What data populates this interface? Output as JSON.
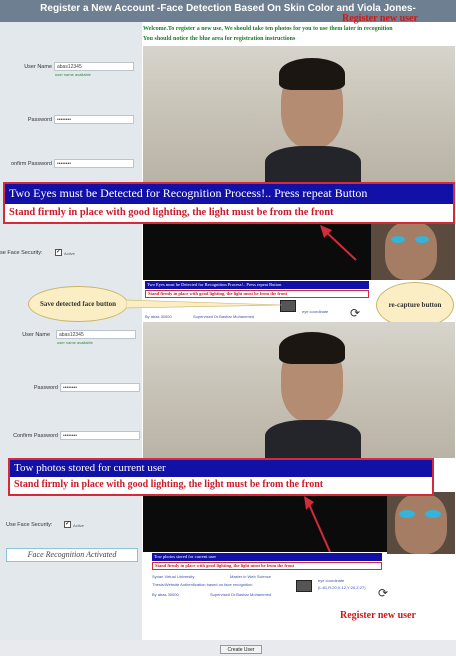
{
  "header": {
    "title": "Register a New Account -Face Detection Based On Skin Color and Viola Jones-",
    "register_label": "Register new user"
  },
  "top_form": {
    "welcome_line1": "Welcome.To register a new use, We should take ten photos for you to use them later in recognition",
    "welcome_line2": "You should notice the blue area for registration instructions",
    "username_label": "User Name",
    "username_value": "abas12345",
    "username_hint": "user name available",
    "password_label": "Password",
    "password_value": "••••••••",
    "confirm_label": "onfirm Password",
    "confirm_value": "••••••••",
    "face_security_label": "se Face Security:",
    "face_security_value": "Active"
  },
  "banner1": {
    "line1": "Two Eyes must be Detected for Recognition Process!.. Press repeat Button",
    "line2": "Stand firmly in place with good lighting, the light must be from the front"
  },
  "small_status1": {
    "line1": "Two Eyes must be Detected for Recognition Process!.. Press repeat Button",
    "line2": "Stand firmly in place with good lighting, the light must be from the front",
    "uni": "Syrian Virtual University",
    "master": "Master in Web Science",
    "by": "By abas 30000",
    "supervisor": "Supervised Dr.Bashar Mohammed",
    "coords": "eye coordinate"
  },
  "callouts": {
    "save": "Save detected face button",
    "recapture": "re-capture button"
  },
  "bottom_form": {
    "username_label": "User Name",
    "username_value": "abas12345",
    "username_hint": "user name available",
    "password_label": "Password",
    "password_value": "••••••••",
    "confirm_label": "Confirm Password",
    "confirm_value": "••••••••",
    "face_security_label": "Use Face Security:",
    "face_security_value": "Active",
    "activated_label": "Face Recognition Activated"
  },
  "banner2": {
    "line1": "Tow photos stored for current user",
    "line2": "Stand firmly in place with good lighting, the light must be from the front"
  },
  "small_status2": {
    "line1": "Tow photos stored for current user",
    "line2": "Stand firmly in place with good lighting, the light must be from the front",
    "uni": "Syrian Virtual University",
    "master": "Master in Web Science",
    "thesis": "Thesis/Website Authentication based on face recognition",
    "by": "By abas 30000",
    "supervisor": "Supervised Dr.Bashar Mohammed",
    "coords": "eye coordinate",
    "coords_value": "(L:81,R:20,X:12,Y:20,Z:27)"
  },
  "register_bottom": "Register new user",
  "create_button": "Create User",
  "colors": {
    "accent_blue": "#1111a8",
    "accent_red": "#d42a3a",
    "topbar": "#6d7f90"
  }
}
